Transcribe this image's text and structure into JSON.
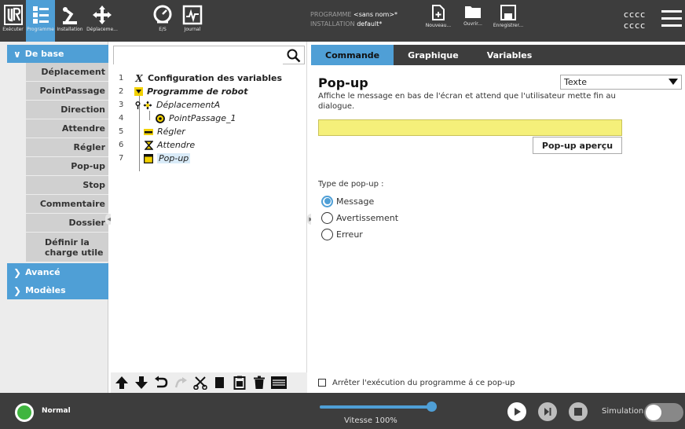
{
  "topbar": {
    "nav": [
      {
        "id": "run",
        "label": "Exécuter",
        "icon": "ur-logo-icon"
      },
      {
        "id": "program",
        "label": "Programme",
        "icon": "program-tree-icon",
        "active": true
      },
      {
        "id": "install",
        "label": "Installation",
        "icon": "robot-arm-icon"
      },
      {
        "id": "move",
        "label": "Déplaceme...",
        "icon": "move-cross-icon"
      },
      {
        "id": "io",
        "label": "E/S",
        "icon": "io-gauge-icon"
      },
      {
        "id": "log",
        "label": "Journal",
        "icon": "log-chart-icon"
      }
    ],
    "program_key": "PROGRAMME",
    "program_value": "<sans nom>*",
    "installation_key": "INSTALLATION",
    "installation_value": "default*",
    "file_buttons": {
      "new_label": "Nouveau...",
      "open_label": "Ouvrir...",
      "save_label": "Enregistrer..."
    },
    "user_code_1": "cccc",
    "user_code_2": "cccc"
  },
  "sidebar": {
    "categories": {
      "basic": "De base",
      "advanced": "Avancé",
      "templates": "Modèles"
    },
    "items": [
      "Déplacement",
      "PointPassage",
      "Direction",
      "Attendre",
      "Régler",
      "Pop-up",
      "Stop",
      "Commentaire",
      "Dossier"
    ],
    "payload_item_line1": "Définir la",
    "payload_item_line2": "charge utile"
  },
  "tree": {
    "search_placeholder": "",
    "rows": [
      {
        "num": "1",
        "label": "Configuration des variables"
      },
      {
        "num": "2",
        "label": "Programme de robot"
      },
      {
        "num": "3",
        "label": "DéplacementA"
      },
      {
        "num": "4",
        "label": "PointPassage_1"
      },
      {
        "num": "5",
        "label": "Régler"
      },
      {
        "num": "6",
        "label": "Attendre"
      },
      {
        "num": "7",
        "label": "Pop-up"
      }
    ]
  },
  "right": {
    "tabs": [
      "Commande",
      "Graphique",
      "Variables"
    ],
    "title": "Pop-up",
    "description": "Affiche le message en bas de l'écran et attend que l'utilisateur mette fin au dialogue.",
    "type_select_value": "Texte",
    "message_value": "",
    "preview_button": "Pop-up aperçu",
    "popup_type_label": "Type de pop-up :",
    "radios": [
      "Message",
      "Avertissement",
      "Erreur"
    ],
    "selected_radio": 0,
    "stop_checkbox_label": "Arrêter l'exécution du programme á ce pop-up",
    "stop_checked": false
  },
  "bottombar": {
    "status": "Normal",
    "status_color": "#3fb53f",
    "speed_text": "Vitesse 100%",
    "speed_fraction": 1.0,
    "simulation_label": "Simulation",
    "simulation_on": false
  },
  "colors": {
    "accent": "#4f9fd6",
    "dark_bar": "#3d3d3d",
    "input_yellow": "#f5f07a"
  }
}
